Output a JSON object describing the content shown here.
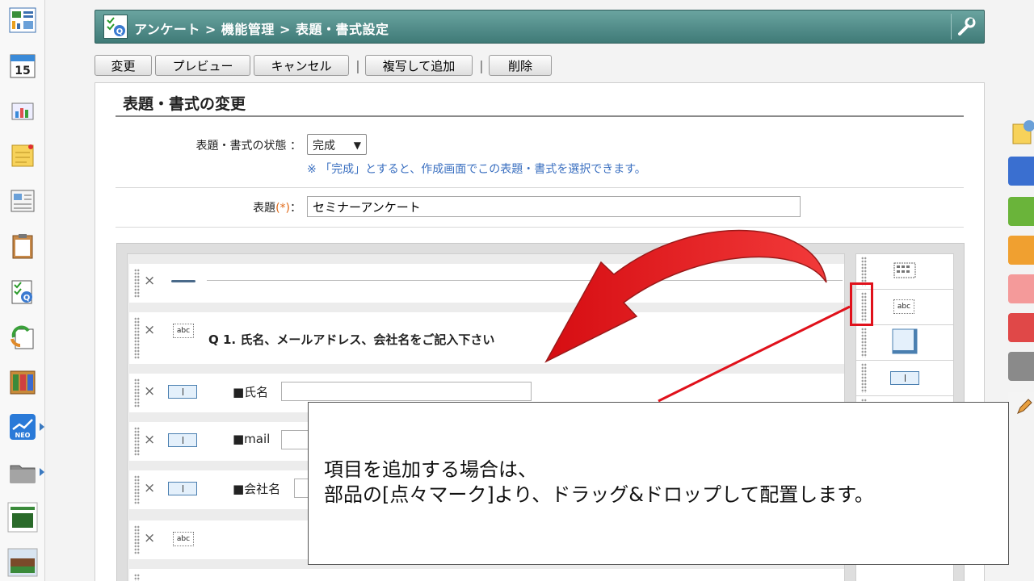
{
  "header": {
    "breadcrumb": "アンケート > 機能管理 > 表題・書式設定"
  },
  "toolbar": {
    "change_label": "変更",
    "preview_label": "プレビュー",
    "cancel_label": "キャンセル",
    "separator": "|",
    "copy_add_label": "複写して追加",
    "delete_label": "削除"
  },
  "form": {
    "section_title": "表題・書式の変更",
    "status_label": "表題・書式の状態 ：",
    "status_value": "完成",
    "status_hint": "※ 「完成」とすると、作成画面でこの表題・書式を選択できます。",
    "title_label_prefix": "表題",
    "title_required_mark": "(*)",
    "title_label_suffix": "：",
    "title_value": "セミナーアンケート"
  },
  "builder": {
    "remove_glyph": "×",
    "question_text": "Q 1. 氏名、メールアドレス、会社名をご記入下さい",
    "fields": [
      "■氏名",
      "■mail",
      "■会社名"
    ],
    "abc_text": "abc"
  },
  "callout": {
    "line1": "項目を追加する場合は、",
    "line2": "部品の[点々マーク]より、ドラッグ&ドロップして配置します。"
  },
  "colors": {
    "header": "#4f8a86",
    "annotation_red": "#e0111b",
    "hint_blue": "#3a6fc0"
  },
  "icons": [
    "app-grid-icon",
    "calendar-icon",
    "chart-board-icon",
    "memo-icon",
    "bulletin-icon",
    "clipboard-icon",
    "survey-icon",
    "recycle-doc-icon",
    "binders-icon",
    "neo-icon",
    "folder-icon",
    "wrench-icon",
    "line-part-icon",
    "abc-part-icon",
    "text-field-part-icon"
  ]
}
